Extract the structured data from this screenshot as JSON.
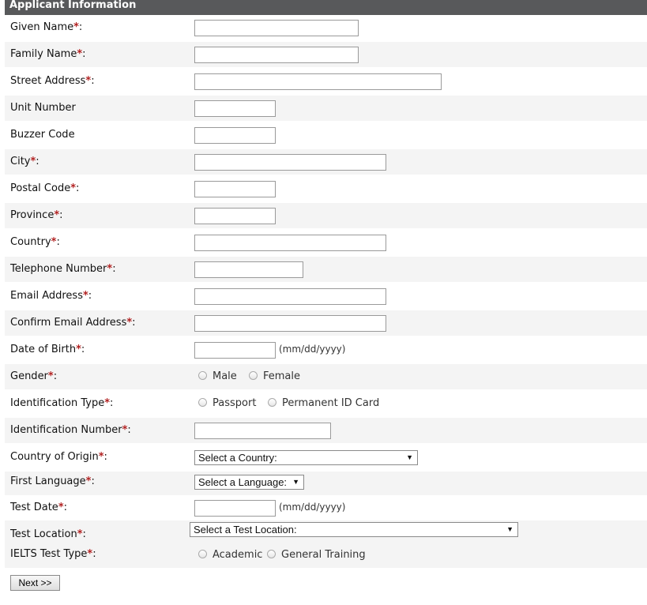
{
  "header": {
    "title": "Applicant Information"
  },
  "required_marker": "*",
  "colon": ":",
  "fields": {
    "given_name": "Given Name",
    "family_name": "Family Name",
    "street_address": "Street Address",
    "unit_number": "Unit Number",
    "buzzer_code": "Buzzer Code",
    "city": "City",
    "postal_code": "Postal Code",
    "province": "Province",
    "country": "Country",
    "telephone": "Telephone Number",
    "email": "Email Address",
    "confirm_email": "Confirm Email Address",
    "dob": "Date of Birth",
    "gender": "Gender",
    "id_type": "Identification Type",
    "id_number": "Identification Number",
    "country_origin": "Country of Origin",
    "first_language": "First Language",
    "test_date": "Test Date",
    "test_location": "Test Location",
    "ielts_type": "IELTS Test Type"
  },
  "date_hint": "(mm/dd/yyyy)",
  "gender_options": [
    "Male",
    "Female"
  ],
  "id_type_options": [
    "Passport",
    "Permanent ID Card"
  ],
  "ielts_type_options": [
    "Academic",
    "General Training"
  ],
  "selects": {
    "country_origin": "Select a Country:",
    "first_language": "Select a Language:",
    "test_location": "Select a Test Location:"
  },
  "next_button": "Next >>"
}
